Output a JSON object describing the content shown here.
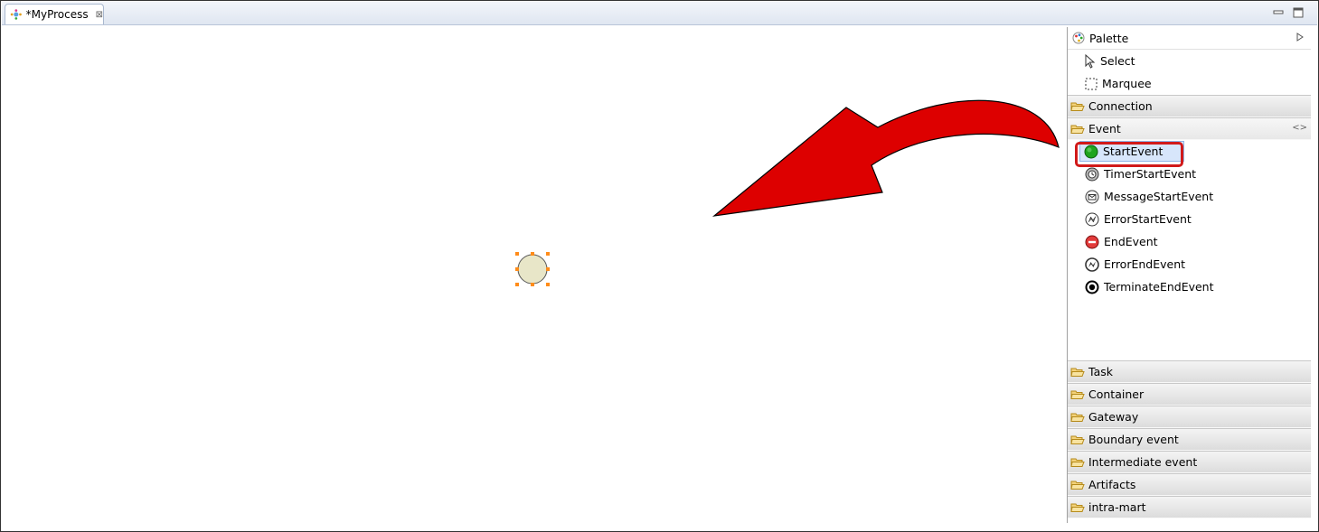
{
  "editor": {
    "tab_title": "*MyProcess",
    "close_glyph": "⊠"
  },
  "palette": {
    "title": "Palette",
    "tools": [
      {
        "label": "Select",
        "icon": "pointer-arrow-icon"
      },
      {
        "label": "Marquee",
        "icon": "marquee-dashed-icon"
      }
    ],
    "drawers": {
      "connection": "Connection",
      "event": "Event",
      "task": "Task",
      "container": "Container",
      "gateway": "Gateway",
      "boundary": "Boundary event",
      "intermediate": "Intermediate event",
      "artifacts": "Artifacts",
      "intramart": "intra-mart"
    },
    "event_items": [
      {
        "label": "StartEvent",
        "icon": "start-event-icon",
        "selected": true
      },
      {
        "label": "TimerStartEvent",
        "icon": "timer-start-event-icon"
      },
      {
        "label": "MessageStartEvent",
        "icon": "message-start-event-icon"
      },
      {
        "label": "ErrorStartEvent",
        "icon": "error-start-event-icon"
      },
      {
        "label": "EndEvent",
        "icon": "end-event-icon"
      },
      {
        "label": "ErrorEndEvent",
        "icon": "error-end-event-icon"
      },
      {
        "label": "TerminateEndEvent",
        "icon": "terminate-end-event-icon"
      }
    ]
  },
  "colors": {
    "highlight": "#d11a1a",
    "arrow_fill": "#dd0000",
    "node_fill": "#e8e6c8",
    "handle": "#ff8c1a",
    "start_green": "#1fa51f",
    "end_red": "#e23b3b"
  }
}
